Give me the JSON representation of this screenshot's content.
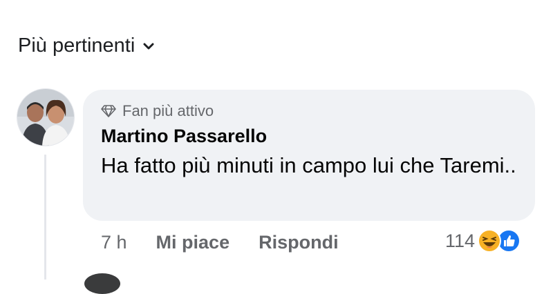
{
  "sort": {
    "label": "Più pertinenti",
    "icon": "chevron-down-icon"
  },
  "comment": {
    "badge_icon": "diamond-icon",
    "badge": "Fan più attivo",
    "author": "Martino Passarello",
    "text": "Ha fatto più minuti in campo lui che Taremi..",
    "time": "7 h",
    "like_label": "Mi piace",
    "reply_label": "Rispondi",
    "reaction_count": "114",
    "reaction_icons": [
      "haha-icon",
      "like-icon"
    ]
  },
  "colors": {
    "bubble": "#f0f2f5",
    "muted": "#65676b",
    "like_blue": "#1877f2",
    "haha_yellow": "#f7b125"
  }
}
